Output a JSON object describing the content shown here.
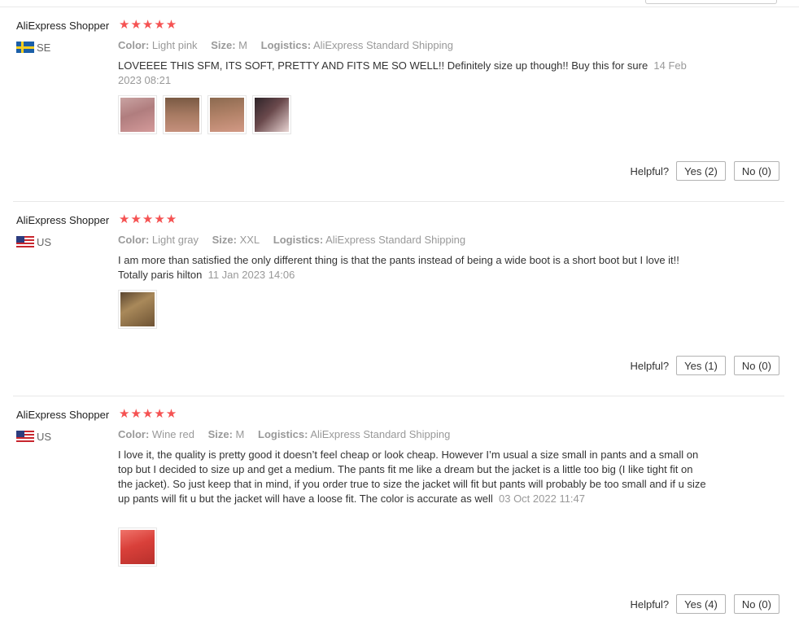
{
  "colors": {
    "star": "#f55252",
    "meta": "#999999",
    "text": "#333333"
  },
  "labels": {
    "color": "Color:",
    "size": "Size:",
    "logistics": "Logistics:",
    "helpful": "Helpful?"
  },
  "reviews": [
    {
      "user": "AliExpress Shopper",
      "stars": "★★★★★",
      "rating": 5,
      "country": "SE",
      "flag_icon": "flag-sweden-icon",
      "color": "Light pink",
      "size": "M",
      "logistics": "AliExpress Standard Shipping",
      "text": "LOVEEEE THIS SFM, ITS SOFT, PRETTY AND FITS ME SO WELL!! Definitely size up though!! Buy this for sure",
      "date": "14 Feb 2023 08:21",
      "photos": [
        {
          "name": "review-photo-1",
          "color": "#b9898a"
        },
        {
          "name": "review-photo-2",
          "color": "#9a6b55"
        },
        {
          "name": "review-photo-3",
          "color": "#a2785e"
        },
        {
          "name": "review-photo-4",
          "color": "#6b4a4d"
        }
      ],
      "yes": "Yes (2)",
      "no": "No (0)"
    },
    {
      "user": "AliExpress Shopper",
      "stars": "★★★★★",
      "rating": 5,
      "country": "US",
      "flag_icon": "flag-usa-icon",
      "color": "Light gray",
      "size": "XXL",
      "logistics": "AliExpress Standard Shipping",
      "text": "I am more than satisfied the only different thing is that the pants instead of being a wide boot is a short boot but I love it!! Totally paris hilton",
      "date": "11 Jan 2023 14:06",
      "photos": [
        {
          "name": "review-photo-1",
          "color": "#8a6a3e"
        }
      ],
      "yes": "Yes (1)",
      "no": "No (0)"
    },
    {
      "user": "AliExpress Shopper",
      "stars": "★★★★★",
      "rating": 5,
      "country": "US",
      "flag_icon": "flag-usa-icon",
      "color": "Wine red",
      "size": "M",
      "logistics": "AliExpress Standard Shipping",
      "text": "I love it, the quality is pretty good it doesn’t feel cheap or look cheap. However I’m usual a size small in pants and a small on top but I decided to size up and get a medium. The pants fit me like a dream but the jacket is a little too big (I like tight fit on the jacket). So just keep that in mind, if you order true to size the jacket will fit but pants will probably be too small and if u size up pants will fit u but the jacket will have a loose fit. The color is accurate as well",
      "date": "03 Oct 2022 11:47",
      "photos": [
        {
          "name": "review-photo-1",
          "color": "#d9403a"
        }
      ],
      "yes": "Yes (4)",
      "no": "No (0)"
    }
  ]
}
